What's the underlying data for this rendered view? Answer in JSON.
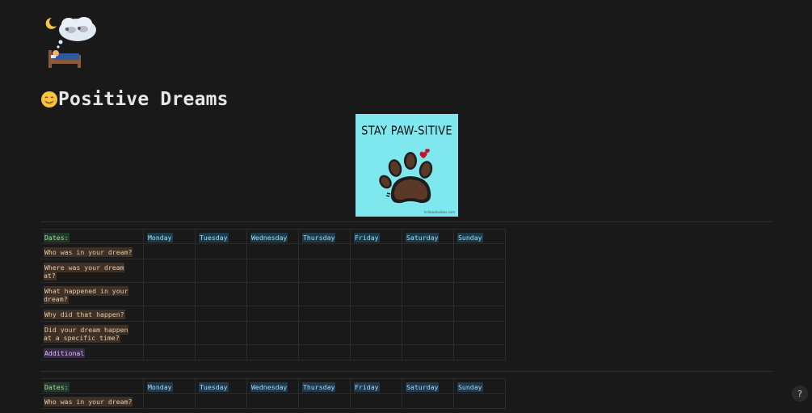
{
  "page": {
    "title": "Positive Dreams",
    "title_icon": "smiling-face-icon",
    "page_icon": "sleeping-in-bed-with-dream-bubble-icon"
  },
  "cover": {
    "headline": "STAY PAW-SITIVE",
    "credit": "hellowebvibes.com",
    "background": "#7ee8ee"
  },
  "tables": [
    {
      "header": {
        "label": "Dates:",
        "days": [
          "Monday",
          "Tuesday",
          "Wednesday",
          "Thursday",
          "Friday",
          "Saturday",
          "Sunday"
        ]
      },
      "rows": [
        "Who was in your dream?",
        "Where was your dream at?",
        "What happened in your dream?",
        "Why did that happen?",
        "Did your dream happen at a specific time?",
        "Additional"
      ]
    },
    {
      "header": {
        "label": "Dates:",
        "days": [
          "Monday",
          "Tuesday",
          "Wednesday",
          "Thursday",
          "Friday",
          "Saturday",
          "Sunday"
        ]
      },
      "rows": [
        "Who was in your dream?"
      ]
    }
  ],
  "help": {
    "label": "?"
  },
  "colors": {
    "background": "#191919",
    "header_highlight_green": "#23392b",
    "day_highlight_blue": "#1c3a4a",
    "question_highlight_brown": "#3e3024",
    "additional_highlight_purple": "#3a2a45"
  }
}
